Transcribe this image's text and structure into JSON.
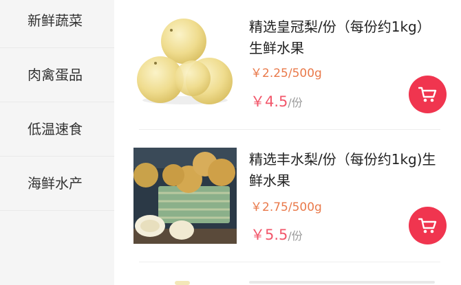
{
  "sidebar": {
    "items": [
      {
        "label": "新鲜蔬菜"
      },
      {
        "label": "肉禽蛋品"
      },
      {
        "label": "低温速食"
      },
      {
        "label": "海鲜水产"
      }
    ]
  },
  "products": [
    {
      "title": "精选皇冠梨/份（每份约1kg）生鲜水果",
      "unit_price": "￥2.25/500g",
      "price_symbol": "￥",
      "price_value": "4.5",
      "price_unit": "/份",
      "image_icon": "crown-pear-photo"
    },
    {
      "title": "精选丰水梨/份（每份约1kg)生鲜水果",
      "unit_price": "￥2.75/500g",
      "price_symbol": "￥",
      "price_value": "5.5",
      "price_unit": "/份",
      "image_icon": "fengshui-pear-basket-photo"
    }
  ],
  "colors": {
    "accent": "#f0354f",
    "unit_price": "#e9794a",
    "price": "#f2576b",
    "sidebar_bg": "#f5f5f5"
  }
}
